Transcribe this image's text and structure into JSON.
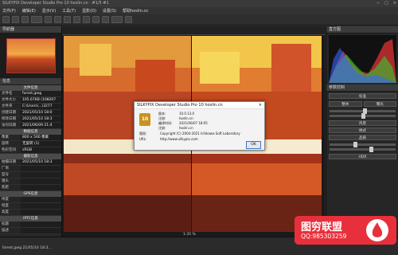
{
  "window": {
    "title": "SILKYPIX Developer Studio Pro 10 hoslin.cn · #1/5 #1"
  },
  "menu": [
    "文件(F)",
    "编辑(E)",
    "显示(V)",
    "工具(T)",
    "显影(D)",
    "设置(S)",
    "帮助(H)"
  ],
  "menu_extra": "帮助hoslin.cn",
  "left_panel": {
    "header": "导航器",
    "info_tab": "信息",
    "sections": [
      {
        "title": "文件信息",
        "rows": [
          [
            "文件名",
            "forest.jpeg"
          ],
          [
            "文件大小",
            "105.67KB (108207"
          ],
          [
            "文件夹",
            "C:\\Users\\...\\3277"
          ],
          [
            "创建日期",
            "2021/05/10 18:0"
          ],
          [
            "修改日期",
            "2021/05/10 18:3"
          ],
          [
            "访问日期",
            "2021/06/09 21:4"
          ]
        ]
      },
      {
        "title": "数据信息",
        "rows": [
          [
            "像素",
            "800 x 500 像素"
          ],
          [
            "旋转",
            "无旋转 (1)"
          ],
          [
            "色彩空间",
            "sRGB"
          ]
        ]
      },
      {
        "title": "摄影信息",
        "rows": [
          [
            "拍摄日期",
            "2021/05/10 18:3"
          ],
          [
            "厂商",
            ""
          ],
          [
            "型号",
            ""
          ],
          [
            "镜头",
            ""
          ],
          [
            "焦距",
            ""
          ]
        ]
      },
      {
        "title": "GPS信息",
        "rows": [
          [
            "纬度",
            ""
          ],
          [
            "经度",
            ""
          ],
          [
            "高度",
            ""
          ]
        ]
      },
      {
        "title": "IPTC信息",
        "rows": [
          [
            "标题",
            ""
          ],
          [
            "描述",
            ""
          ]
        ]
      }
    ]
  },
  "viewer": {
    "zoom": "1:35 %"
  },
  "right_panel": {
    "histogram_header": "直方图",
    "control_header": "参数控制",
    "presets": [
      "标准",
      "风景",
      "样式",
      "品质"
    ],
    "buttons": [
      "整体",
      "曝光",
      "高光",
      "暗调"
    ],
    "modes": [
      "HDR"
    ]
  },
  "dialog": {
    "title": "SILKYPIX Developer Studio Pro 10 hoslin.cn",
    "close": "×",
    "logo": "10",
    "lines": [
      {
        "k": "版本:",
        "v": "10.0.13.0"
      },
      {
        "k": "注册:",
        "v": "hoslin.cn"
      },
      {
        "k": "编译时间:",
        "v": "2021/06/07 18:05"
      },
      {
        "k": "注册:",
        "v": "hoslin.cn"
      },
      {
        "k": "版权:",
        "v": "Copyright (C) 2004-2021 Ichikawa Soft Laboratory"
      },
      {
        "k": "URL:",
        "v": "http://www.silkypix.com"
      }
    ],
    "ok": "OK"
  },
  "status": {
    "text": "forest.jpeg 21/05/10 18:3..."
  },
  "watermark": {
    "main": "图穷联盟",
    "sub": "QQ:985303259"
  }
}
